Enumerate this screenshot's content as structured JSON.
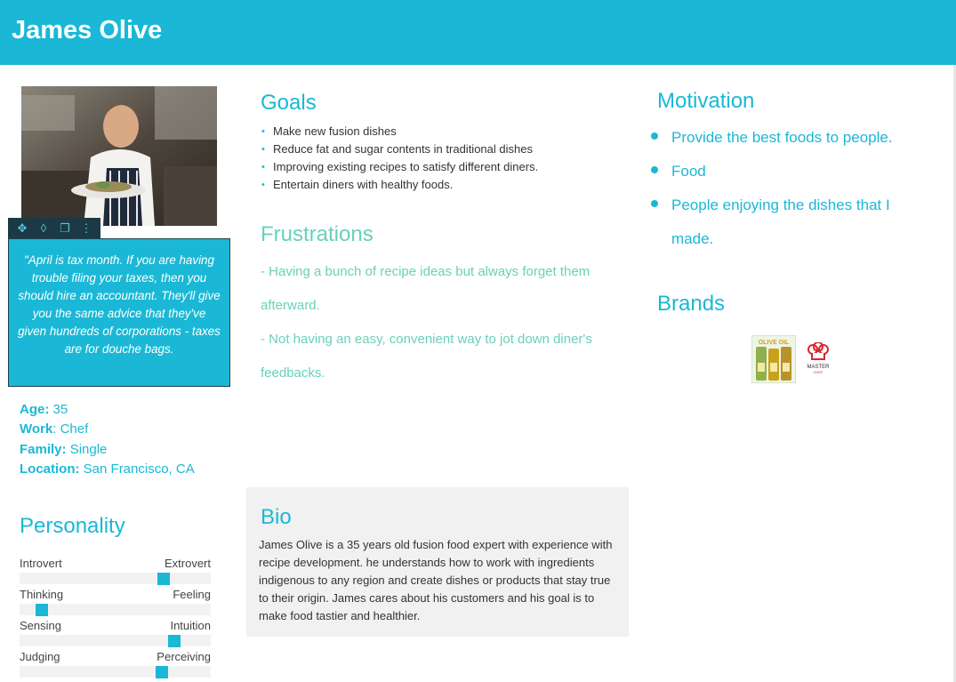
{
  "header": {
    "name": "James Olive"
  },
  "quote": "\"April is tax month. If you are having trouble filing your taxes, then you should hire an accountant. They'll give you the same advice that they've given hundreds of corporations - taxes are for douche bags.",
  "edit_toolbar": {
    "icons": [
      "move-icon",
      "drop-icon",
      "crop-icon",
      "more-icon"
    ]
  },
  "facts": {
    "age_label": "Age:",
    "age_value": "35",
    "work_label": "Work",
    "work_value": ": Chef",
    "family_label": "Family:",
    "family_value": "Single",
    "location_label": "Location:",
    "location_value": "San Francisco, CA"
  },
  "personality": {
    "title": "Personality",
    "scales": [
      {
        "left": "Introvert",
        "right": "Extrovert",
        "level": 0.77
      },
      {
        "left": "Thinking",
        "right": "Feeling",
        "level": 0.09
      },
      {
        "left": "Sensing",
        "right": "Intuition",
        "level": 0.83
      },
      {
        "left": "Judging",
        "right": "Perceiving",
        "level": 0.76
      }
    ]
  },
  "goals": {
    "title": "Goals",
    "items": [
      "Make new fusion dishes",
      "Reduce fat and sugar contents in traditional dishes",
      "Improving existing recipes to satisfy different diners.",
      "Entertain diners with healthy foods."
    ]
  },
  "frustrations": {
    "title": "Frustrations",
    "items": [
      "- Having a bunch of recipe ideas but always forget them afterward.",
      "- Not having an easy, convenient way to jot down diner's feedbacks."
    ]
  },
  "bio": {
    "title": "Bio",
    "text": "James Olive is a 35 years old fusion food expert with experience with recipe development. he understands how to work with ingredients indigenous to any region and create dishes or products that stay true to their origin. James cares about his customers and his goal is to make food tastier and healthier."
  },
  "motivation": {
    "title": "Motivation",
    "items": [
      "Provide the best foods to people.",
      "Food",
      "People enjoying the dishes that I made."
    ]
  },
  "brands": {
    "title": "Brands",
    "olive_label": "OLIVE OIL",
    "master_line1": "MASTER",
    "master_line2": "CHEF"
  },
  "colors": {
    "accent": "#1ab8d6",
    "green": "#69d1b9",
    "dark": "#1b3a45"
  }
}
